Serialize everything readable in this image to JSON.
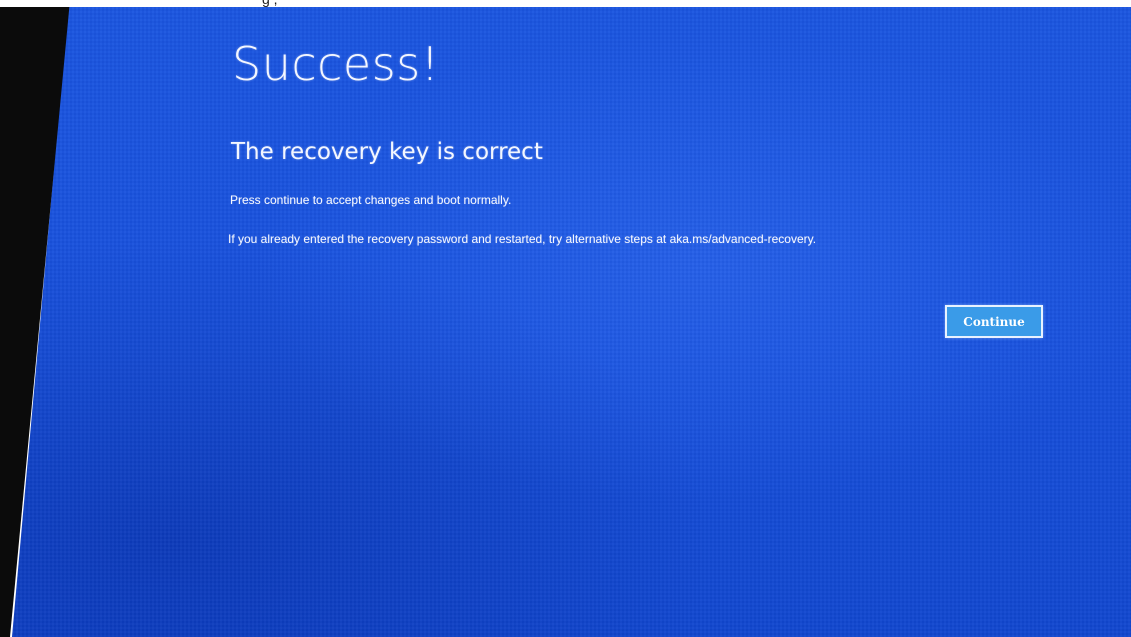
{
  "header_fragment": "g                    ,",
  "title": "Success!",
  "subtitle": "The recovery key is correct",
  "messages": {
    "line1": "Press continue to accept changes and boot normally.",
    "line2": "If you already entered the recovery password and restarted, try alternative steps at aka.ms/advanced-recovery."
  },
  "continue_button": {
    "label": "Continue"
  },
  "colors": {
    "screen_background": "#1750dc",
    "button_background": "#3a9be8",
    "button_border": "#e8f2ff",
    "text": "#f4f7ff"
  }
}
